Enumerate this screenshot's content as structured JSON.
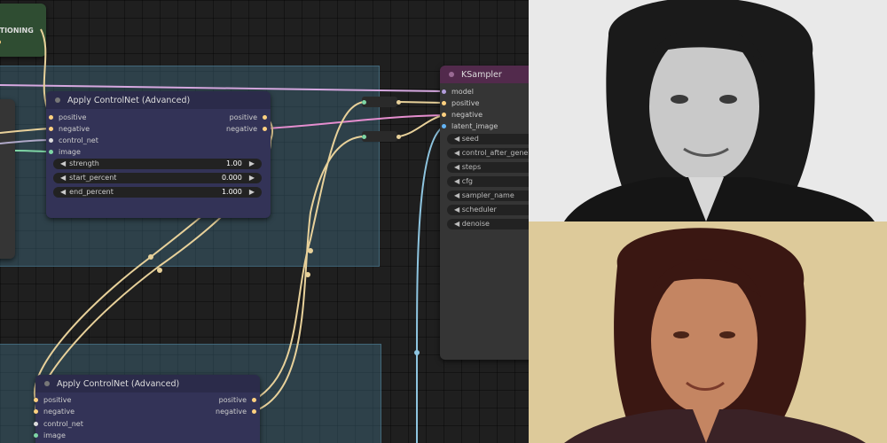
{
  "conditioning_node": {
    "output_label": "DITIONING"
  },
  "controlnet_node_1": {
    "title": "Apply ControlNet (Advanced)",
    "inputs": [
      "positive",
      "negative",
      "control_net",
      "image"
    ],
    "outputs": [
      "positive",
      "negative"
    ],
    "widgets": [
      {
        "label": "strength",
        "value": "1.00"
      },
      {
        "label": "start_percent",
        "value": "0.000"
      },
      {
        "label": "end_percent",
        "value": "1.000"
      }
    ]
  },
  "controlnet_node_2": {
    "title": "Apply ControlNet (Advanced)",
    "inputs": [
      "positive",
      "negative",
      "control_net",
      "image"
    ],
    "outputs": [
      "positive",
      "negative"
    ]
  },
  "ksampler_node": {
    "title": "KSampler",
    "inputs": [
      "model",
      "positive",
      "negative",
      "latent_image"
    ],
    "widgets": [
      "seed",
      "control_after_generate",
      "steps",
      "cfg",
      "sampler_name",
      "scheduler",
      "denoise"
    ]
  },
  "colors": {
    "model_pin": "#b39ddb",
    "conditioning_pin": "#ffd180",
    "control_net_pin": "#4db6ac",
    "image_pin": "#64b5f6",
    "latent_pin": "#ff9cf9"
  }
}
